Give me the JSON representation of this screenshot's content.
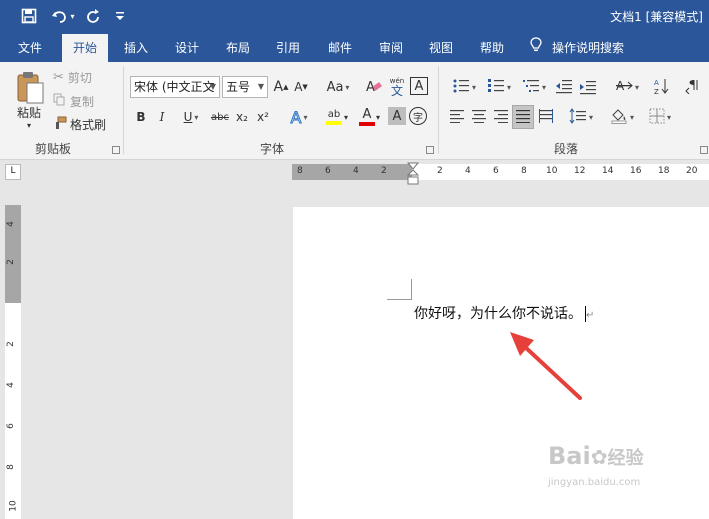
{
  "title_bar": {
    "document_title": "文档1 [兼容模式]",
    "quick_access": [
      "save-icon",
      "undo-icon",
      "redo-icon",
      "customize-icon"
    ]
  },
  "ribbon_tabs": [
    "文件",
    "开始",
    "插入",
    "设计",
    "布局",
    "引用",
    "邮件",
    "审阅",
    "视图",
    "帮助",
    "操作说明搜索"
  ],
  "active_tab": "开始",
  "clipboard": {
    "paste": "粘贴",
    "cut": "剪切",
    "copy": "复制",
    "format_painter": "格式刷",
    "group_label": "剪贴板"
  },
  "font": {
    "font_name": "宋体 (中文正文",
    "font_size": "五号",
    "grow": "A",
    "shrink": "A",
    "case": "Aa",
    "phonetic_top": "wén",
    "phonetic_bottom": "文",
    "border_char": "A",
    "bold": "B",
    "italic": "I",
    "underline": "U",
    "strike": "abc",
    "subscript": "x₂",
    "superscript": "x²",
    "effects": "A",
    "highlight": "ab",
    "color": "A",
    "shading": "A",
    "enclose": "字",
    "group_label": "字体"
  },
  "paragraph": {
    "group_label": "段落"
  },
  "ruler": {
    "h_left": [
      "8",
      "6",
      "4",
      "2"
    ],
    "h_right": [
      "2",
      "4",
      "6",
      "8",
      "10",
      "12",
      "14",
      "16",
      "18",
      "20"
    ],
    "v_labels": [
      "4",
      "2",
      "2",
      "4",
      "6",
      "8",
      "10"
    ],
    "corner": "L"
  },
  "document": {
    "text": "你好呀，为什么你不说话。"
  },
  "watermark": {
    "brand": "Bai",
    "brand2": "经验",
    "url": "jingyan.baidu.com"
  },
  "colors": {
    "accent": "#2b579a",
    "highlight": "#ffff00",
    "font_color": "#e00000",
    "arrow": "#e5413a"
  }
}
